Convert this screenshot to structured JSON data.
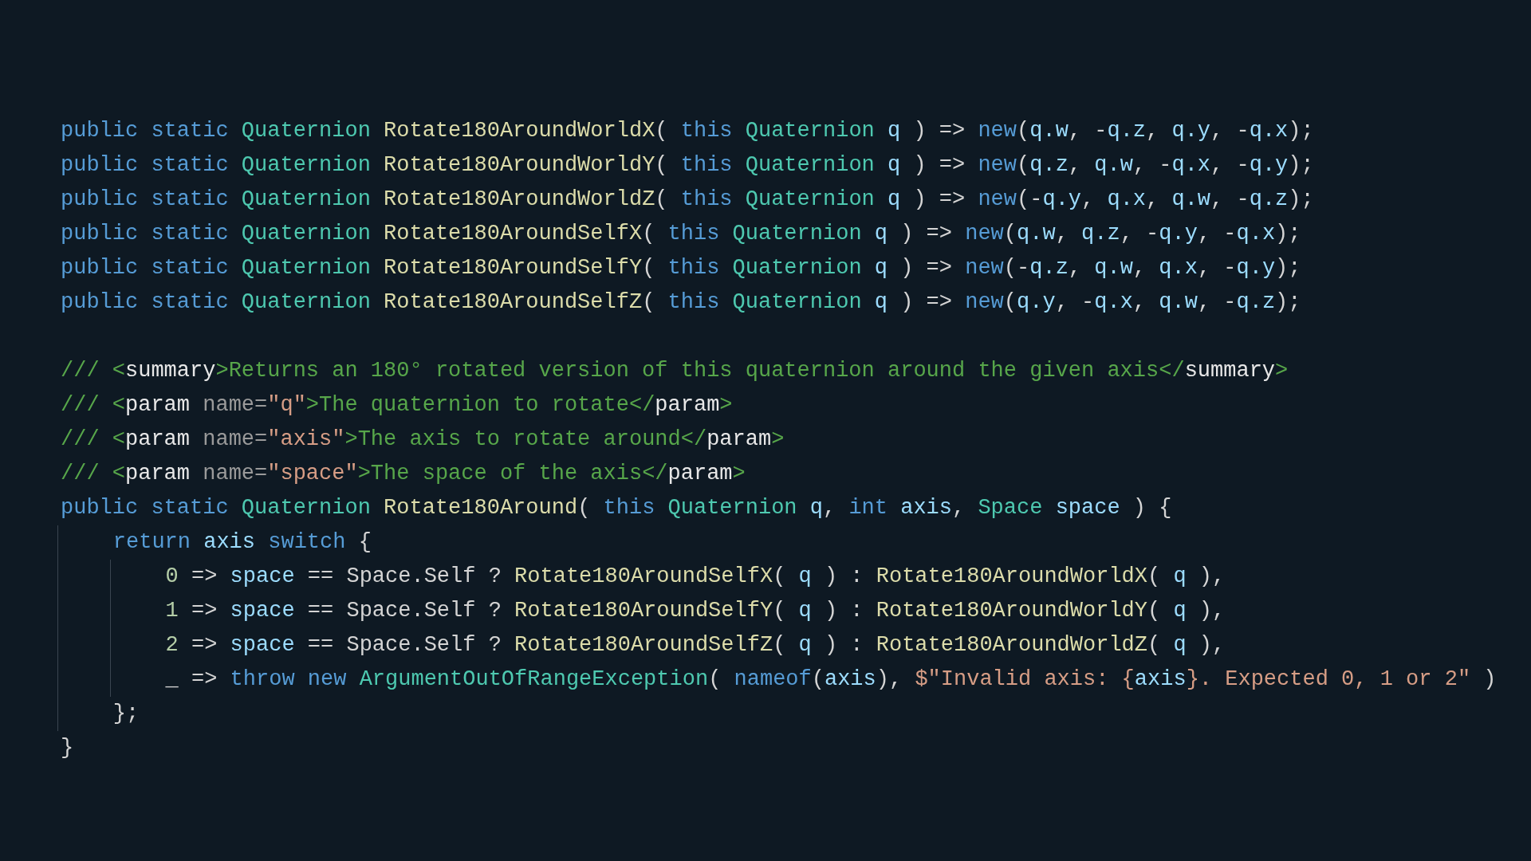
{
  "code_blocks": [
    [
      {
        "tokens": [
          {
            "kind": "kw",
            "text": "public static "
          },
          {
            "kind": "type",
            "text": "Quaternion "
          },
          {
            "kind": "fn",
            "text": "Rotate180AroundWorldX"
          },
          {
            "kind": "p",
            "text": "( "
          },
          {
            "kind": "kw",
            "text": "this "
          },
          {
            "kind": "type",
            "text": "Quaternion "
          },
          {
            "kind": "var",
            "text": "q"
          },
          {
            "kind": "p",
            "text": " ) => "
          },
          {
            "kind": "kw",
            "text": "new"
          },
          {
            "kind": "p",
            "text": "("
          },
          {
            "kind": "var",
            "text": "q.w"
          },
          {
            "kind": "p",
            "text": ", -"
          },
          {
            "kind": "var",
            "text": "q.z"
          },
          {
            "kind": "p",
            "text": ", "
          },
          {
            "kind": "var",
            "text": "q.y"
          },
          {
            "kind": "p",
            "text": ", -"
          },
          {
            "kind": "var",
            "text": "q.x"
          },
          {
            "kind": "p",
            "text": ");"
          }
        ]
      },
      {
        "tokens": [
          {
            "kind": "kw",
            "text": "public static "
          },
          {
            "kind": "type",
            "text": "Quaternion "
          },
          {
            "kind": "fn",
            "text": "Rotate180AroundWorldY"
          },
          {
            "kind": "p",
            "text": "( "
          },
          {
            "kind": "kw",
            "text": "this "
          },
          {
            "kind": "type",
            "text": "Quaternion "
          },
          {
            "kind": "var",
            "text": "q"
          },
          {
            "kind": "p",
            "text": " ) => "
          },
          {
            "kind": "kw",
            "text": "new"
          },
          {
            "kind": "p",
            "text": "("
          },
          {
            "kind": "var",
            "text": "q.z"
          },
          {
            "kind": "p",
            "text": ", "
          },
          {
            "kind": "var",
            "text": "q.w"
          },
          {
            "kind": "p",
            "text": ", -"
          },
          {
            "kind": "var",
            "text": "q.x"
          },
          {
            "kind": "p",
            "text": ", -"
          },
          {
            "kind": "var",
            "text": "q.y"
          },
          {
            "kind": "p",
            "text": ");"
          }
        ]
      },
      {
        "tokens": [
          {
            "kind": "kw",
            "text": "public static "
          },
          {
            "kind": "type",
            "text": "Quaternion "
          },
          {
            "kind": "fn",
            "text": "Rotate180AroundWorldZ"
          },
          {
            "kind": "p",
            "text": "( "
          },
          {
            "kind": "kw",
            "text": "this "
          },
          {
            "kind": "type",
            "text": "Quaternion "
          },
          {
            "kind": "var",
            "text": "q"
          },
          {
            "kind": "p",
            "text": " ) => "
          },
          {
            "kind": "kw",
            "text": "new"
          },
          {
            "kind": "p",
            "text": "(-"
          },
          {
            "kind": "var",
            "text": "q.y"
          },
          {
            "kind": "p",
            "text": ", "
          },
          {
            "kind": "var",
            "text": "q.x"
          },
          {
            "kind": "p",
            "text": ", "
          },
          {
            "kind": "var",
            "text": "q.w"
          },
          {
            "kind": "p",
            "text": ", -"
          },
          {
            "kind": "var",
            "text": "q.z"
          },
          {
            "kind": "p",
            "text": ");"
          }
        ]
      },
      {
        "tokens": [
          {
            "kind": "kw",
            "text": "public static "
          },
          {
            "kind": "type",
            "text": "Quaternion "
          },
          {
            "kind": "fn",
            "text": "Rotate180AroundSelfX"
          },
          {
            "kind": "p",
            "text": "( "
          },
          {
            "kind": "kw",
            "text": "this "
          },
          {
            "kind": "type",
            "text": "Quaternion "
          },
          {
            "kind": "var",
            "text": "q"
          },
          {
            "kind": "p",
            "text": " ) => "
          },
          {
            "kind": "kw",
            "text": "new"
          },
          {
            "kind": "p",
            "text": "("
          },
          {
            "kind": "var",
            "text": "q.w"
          },
          {
            "kind": "p",
            "text": ", "
          },
          {
            "kind": "var",
            "text": "q.z"
          },
          {
            "kind": "p",
            "text": ", -"
          },
          {
            "kind": "var",
            "text": "q.y"
          },
          {
            "kind": "p",
            "text": ", -"
          },
          {
            "kind": "var",
            "text": "q.x"
          },
          {
            "kind": "p",
            "text": ");"
          }
        ]
      },
      {
        "tokens": [
          {
            "kind": "kw",
            "text": "public static "
          },
          {
            "kind": "type",
            "text": "Quaternion "
          },
          {
            "kind": "fn",
            "text": "Rotate180AroundSelfY"
          },
          {
            "kind": "p",
            "text": "( "
          },
          {
            "kind": "kw",
            "text": "this "
          },
          {
            "kind": "type",
            "text": "Quaternion "
          },
          {
            "kind": "var",
            "text": "q"
          },
          {
            "kind": "p",
            "text": " ) => "
          },
          {
            "kind": "kw",
            "text": "new"
          },
          {
            "kind": "p",
            "text": "(-"
          },
          {
            "kind": "var",
            "text": "q.z"
          },
          {
            "kind": "p",
            "text": ", "
          },
          {
            "kind": "var",
            "text": "q.w"
          },
          {
            "kind": "p",
            "text": ", "
          },
          {
            "kind": "var",
            "text": "q.x"
          },
          {
            "kind": "p",
            "text": ", -"
          },
          {
            "kind": "var",
            "text": "q.y"
          },
          {
            "kind": "p",
            "text": ");"
          }
        ]
      },
      {
        "tokens": [
          {
            "kind": "kw",
            "text": "public static "
          },
          {
            "kind": "type",
            "text": "Quaternion "
          },
          {
            "kind": "fn",
            "text": "Rotate180AroundSelfZ"
          },
          {
            "kind": "p",
            "text": "( "
          },
          {
            "kind": "kw",
            "text": "this "
          },
          {
            "kind": "type",
            "text": "Quaternion "
          },
          {
            "kind": "var",
            "text": "q"
          },
          {
            "kind": "p",
            "text": " ) => "
          },
          {
            "kind": "kw",
            "text": "new"
          },
          {
            "kind": "p",
            "text": "("
          },
          {
            "kind": "var",
            "text": "q.y"
          },
          {
            "kind": "p",
            "text": ", -"
          },
          {
            "kind": "var",
            "text": "q.x"
          },
          {
            "kind": "p",
            "text": ", "
          },
          {
            "kind": "var",
            "text": "q.w"
          },
          {
            "kind": "p",
            "text": ", -"
          },
          {
            "kind": "var",
            "text": "q.z"
          },
          {
            "kind": "p",
            "text": ");"
          }
        ]
      }
    ],
    [
      {
        "tokens": [
          {
            "kind": "cm",
            "text": "/// <"
          },
          {
            "kind": "tag",
            "text": "summary"
          },
          {
            "kind": "cm",
            "text": ">Returns an 180° rotated version of this quaternion around the given axis</"
          },
          {
            "kind": "tag",
            "text": "summary"
          },
          {
            "kind": "cm",
            "text": ">"
          }
        ]
      },
      {
        "tokens": [
          {
            "kind": "cm",
            "text": "/// <"
          },
          {
            "kind": "tag",
            "text": "param "
          },
          {
            "kind": "attr",
            "text": "name="
          },
          {
            "kind": "str",
            "text": "\"q\""
          },
          {
            "kind": "cm",
            "text": ">The quaternion to rotate</"
          },
          {
            "kind": "tag",
            "text": "param"
          },
          {
            "kind": "cm",
            "text": ">"
          }
        ]
      },
      {
        "tokens": [
          {
            "kind": "cm",
            "text": "/// <"
          },
          {
            "kind": "tag",
            "text": "param "
          },
          {
            "kind": "attr",
            "text": "name="
          },
          {
            "kind": "str",
            "text": "\"axis\""
          },
          {
            "kind": "cm",
            "text": ">The axis to rotate around</"
          },
          {
            "kind": "tag",
            "text": "param"
          },
          {
            "kind": "cm",
            "text": ">"
          }
        ]
      },
      {
        "tokens": [
          {
            "kind": "cm",
            "text": "/// <"
          },
          {
            "kind": "tag",
            "text": "param "
          },
          {
            "kind": "attr",
            "text": "name="
          },
          {
            "kind": "str",
            "text": "\"space\""
          },
          {
            "kind": "cm",
            "text": ">The space of the axis</"
          },
          {
            "kind": "tag",
            "text": "param"
          },
          {
            "kind": "cm",
            "text": ">"
          }
        ]
      },
      {
        "tokens": [
          {
            "kind": "kw",
            "text": "public static "
          },
          {
            "kind": "type",
            "text": "Quaternion "
          },
          {
            "kind": "fn",
            "text": "Rotate180Around"
          },
          {
            "kind": "p",
            "text": "( "
          },
          {
            "kind": "kw",
            "text": "this "
          },
          {
            "kind": "type",
            "text": "Quaternion "
          },
          {
            "kind": "var",
            "text": "q"
          },
          {
            "kind": "p",
            "text": ", "
          },
          {
            "kind": "kw",
            "text": "int "
          },
          {
            "kind": "var",
            "text": "axis"
          },
          {
            "kind": "p",
            "text": ", "
          },
          {
            "kind": "type",
            "text": "Space "
          },
          {
            "kind": "var",
            "text": "space"
          },
          {
            "kind": "p",
            "text": " ) {"
          }
        ],
        "children": [
          {
            "tokens": [
              {
                "kind": "kw",
                "text": "return "
              },
              {
                "kind": "var",
                "text": "axis "
              },
              {
                "kind": "kw",
                "text": "switch "
              },
              {
                "kind": "p",
                "text": "{"
              }
            ],
            "children": [
              {
                "tokens": [
                  {
                    "kind": "num",
                    "text": "0"
                  },
                  {
                    "kind": "p",
                    "text": " => "
                  },
                  {
                    "kind": "var",
                    "text": "space"
                  },
                  {
                    "kind": "p",
                    "text": " == Space.Self ? "
                  },
                  {
                    "kind": "fn",
                    "text": "Rotate180AroundSelfX"
                  },
                  {
                    "kind": "p",
                    "text": "( "
                  },
                  {
                    "kind": "var",
                    "text": "q"
                  },
                  {
                    "kind": "p",
                    "text": " ) : "
                  },
                  {
                    "kind": "fn",
                    "text": "Rotate180AroundWorldX"
                  },
                  {
                    "kind": "p",
                    "text": "( "
                  },
                  {
                    "kind": "var",
                    "text": "q"
                  },
                  {
                    "kind": "p",
                    "text": " ),"
                  }
                ]
              },
              {
                "tokens": [
                  {
                    "kind": "num",
                    "text": "1"
                  },
                  {
                    "kind": "p",
                    "text": " => "
                  },
                  {
                    "kind": "var",
                    "text": "space"
                  },
                  {
                    "kind": "p",
                    "text": " == Space.Self ? "
                  },
                  {
                    "kind": "fn",
                    "text": "Rotate180AroundSelfY"
                  },
                  {
                    "kind": "p",
                    "text": "( "
                  },
                  {
                    "kind": "var",
                    "text": "q"
                  },
                  {
                    "kind": "p",
                    "text": " ) : "
                  },
                  {
                    "kind": "fn",
                    "text": "Rotate180AroundWorldY"
                  },
                  {
                    "kind": "p",
                    "text": "( "
                  },
                  {
                    "kind": "var",
                    "text": "q"
                  },
                  {
                    "kind": "p",
                    "text": " ),"
                  }
                ]
              },
              {
                "tokens": [
                  {
                    "kind": "num",
                    "text": "2"
                  },
                  {
                    "kind": "p",
                    "text": " => "
                  },
                  {
                    "kind": "var",
                    "text": "space"
                  },
                  {
                    "kind": "p",
                    "text": " == Space.Self ? "
                  },
                  {
                    "kind": "fn",
                    "text": "Rotate180AroundSelfZ"
                  },
                  {
                    "kind": "p",
                    "text": "( "
                  },
                  {
                    "kind": "var",
                    "text": "q"
                  },
                  {
                    "kind": "p",
                    "text": " ) : "
                  },
                  {
                    "kind": "fn",
                    "text": "Rotate180AroundWorldZ"
                  },
                  {
                    "kind": "p",
                    "text": "( "
                  },
                  {
                    "kind": "var",
                    "text": "q"
                  },
                  {
                    "kind": "p",
                    "text": " ),"
                  }
                ]
              },
              {
                "tokens": [
                  {
                    "kind": "p",
                    "text": "_ => "
                  },
                  {
                    "kind": "kw",
                    "text": "throw new "
                  },
                  {
                    "kind": "type",
                    "text": "ArgumentOutOfRangeException"
                  },
                  {
                    "kind": "p",
                    "text": "( "
                  },
                  {
                    "kind": "kw",
                    "text": "nameof"
                  },
                  {
                    "kind": "p",
                    "text": "("
                  },
                  {
                    "kind": "var",
                    "text": "axis"
                  },
                  {
                    "kind": "p",
                    "text": "), "
                  },
                  {
                    "kind": "str",
                    "text": "$\"Invalid axis: {"
                  },
                  {
                    "kind": "var",
                    "text": "axis"
                  },
                  {
                    "kind": "str",
                    "text": "}. Expected 0, 1 or 2\""
                  },
                  {
                    "kind": "p",
                    "text": " )"
                  }
                ]
              }
            ]
          },
          {
            "tokens": [
              {
                "kind": "p",
                "text": "};"
              }
            ]
          }
        ]
      },
      {
        "tokens": [
          {
            "kind": "p",
            "text": "}"
          }
        ]
      }
    ]
  ]
}
